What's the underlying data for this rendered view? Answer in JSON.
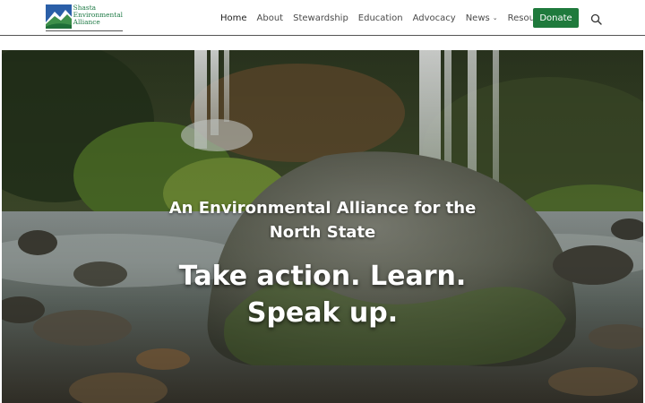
{
  "logo": {
    "line1": "Shasta",
    "line2": "Environmental",
    "line3": "Alliance"
  },
  "nav": {
    "items": [
      {
        "label": "Home",
        "active": true
      },
      {
        "label": "About"
      },
      {
        "label": "Stewardship"
      },
      {
        "label": "Education"
      },
      {
        "label": "Advocacy"
      },
      {
        "label": "News",
        "has_dropdown": true
      },
      {
        "label": "Resources",
        "has_dropdown": true
      }
    ],
    "donate_label": "Donate",
    "search_icon": "search-icon"
  },
  "hero": {
    "subtitle_line1": "An Environmental Alliance for the",
    "subtitle_line2": "North State",
    "title_line1": "Take action. Learn.",
    "title_line2": "Speak up."
  },
  "colors": {
    "brand_green": "#1f7a3c",
    "logo_blue": "#2b5fa8"
  }
}
